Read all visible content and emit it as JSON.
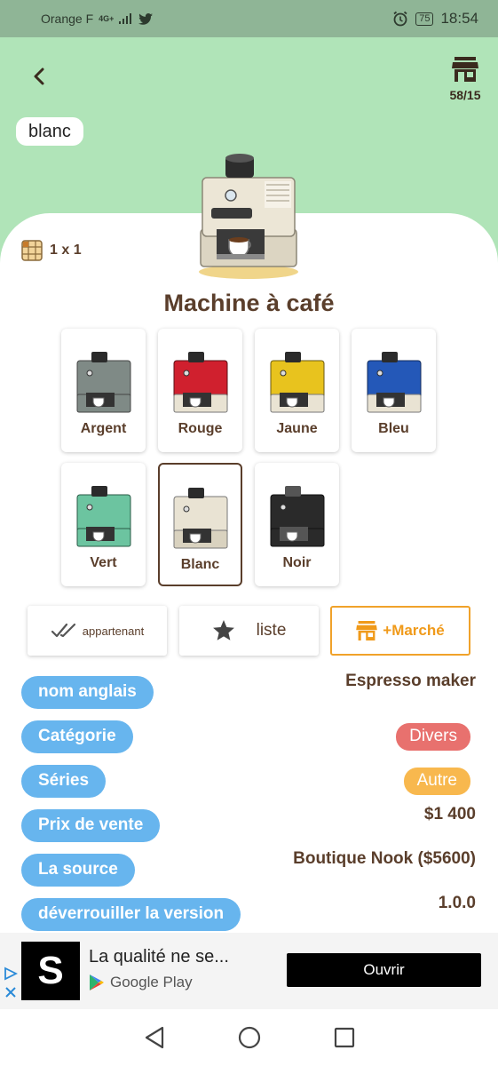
{
  "status": {
    "carrier": "Orange F",
    "network": "4G+",
    "battery": "75",
    "time": "18:54"
  },
  "header": {
    "shop_count": "58/15",
    "variant": "blanc"
  },
  "item": {
    "size": "1 x 1",
    "name": "Machine à café"
  },
  "variants": [
    {
      "label": "Argent",
      "color": "#7f8a86"
    },
    {
      "label": "Rouge",
      "color": "#d0202e"
    },
    {
      "label": "Jaune",
      "color": "#e8c31e"
    },
    {
      "label": "Bleu",
      "color": "#2458b8"
    },
    {
      "label": "Vert",
      "color": "#6cc4a0"
    },
    {
      "label": "Blanc",
      "color": "#e9e3d3"
    },
    {
      "label": "Noir",
      "color": "#2a2a2a"
    }
  ],
  "selected_variant": "Blanc",
  "actions": {
    "owned": "appartenant",
    "wishlist": "liste",
    "market": "+Marché"
  },
  "details": [
    {
      "key": "nom anglais",
      "value": "Espresso maker"
    },
    {
      "key": "Catégorie",
      "value": "Divers",
      "tag_color": "#e8716e"
    },
    {
      "key": "Séries",
      "value": "Autre",
      "tag_color": "#f8b84e"
    },
    {
      "key": "Prix de vente",
      "value": "$1 400"
    },
    {
      "key": "La source",
      "value": "Boutique Nook ($5600)"
    },
    {
      "key": "déverrouiller la version",
      "value": "1.0.0"
    }
  ],
  "ad": {
    "title": "La qualité ne se...",
    "store": "Google Play",
    "cta": "Ouvrir",
    "logo_letter": "S"
  },
  "colors": {
    "header_bg": "#b0e4b8",
    "status_bg": "#8fb596",
    "pill_blue": "#67b5ee",
    "brown": "#5a3e2b",
    "orange": "#f0a22a"
  }
}
